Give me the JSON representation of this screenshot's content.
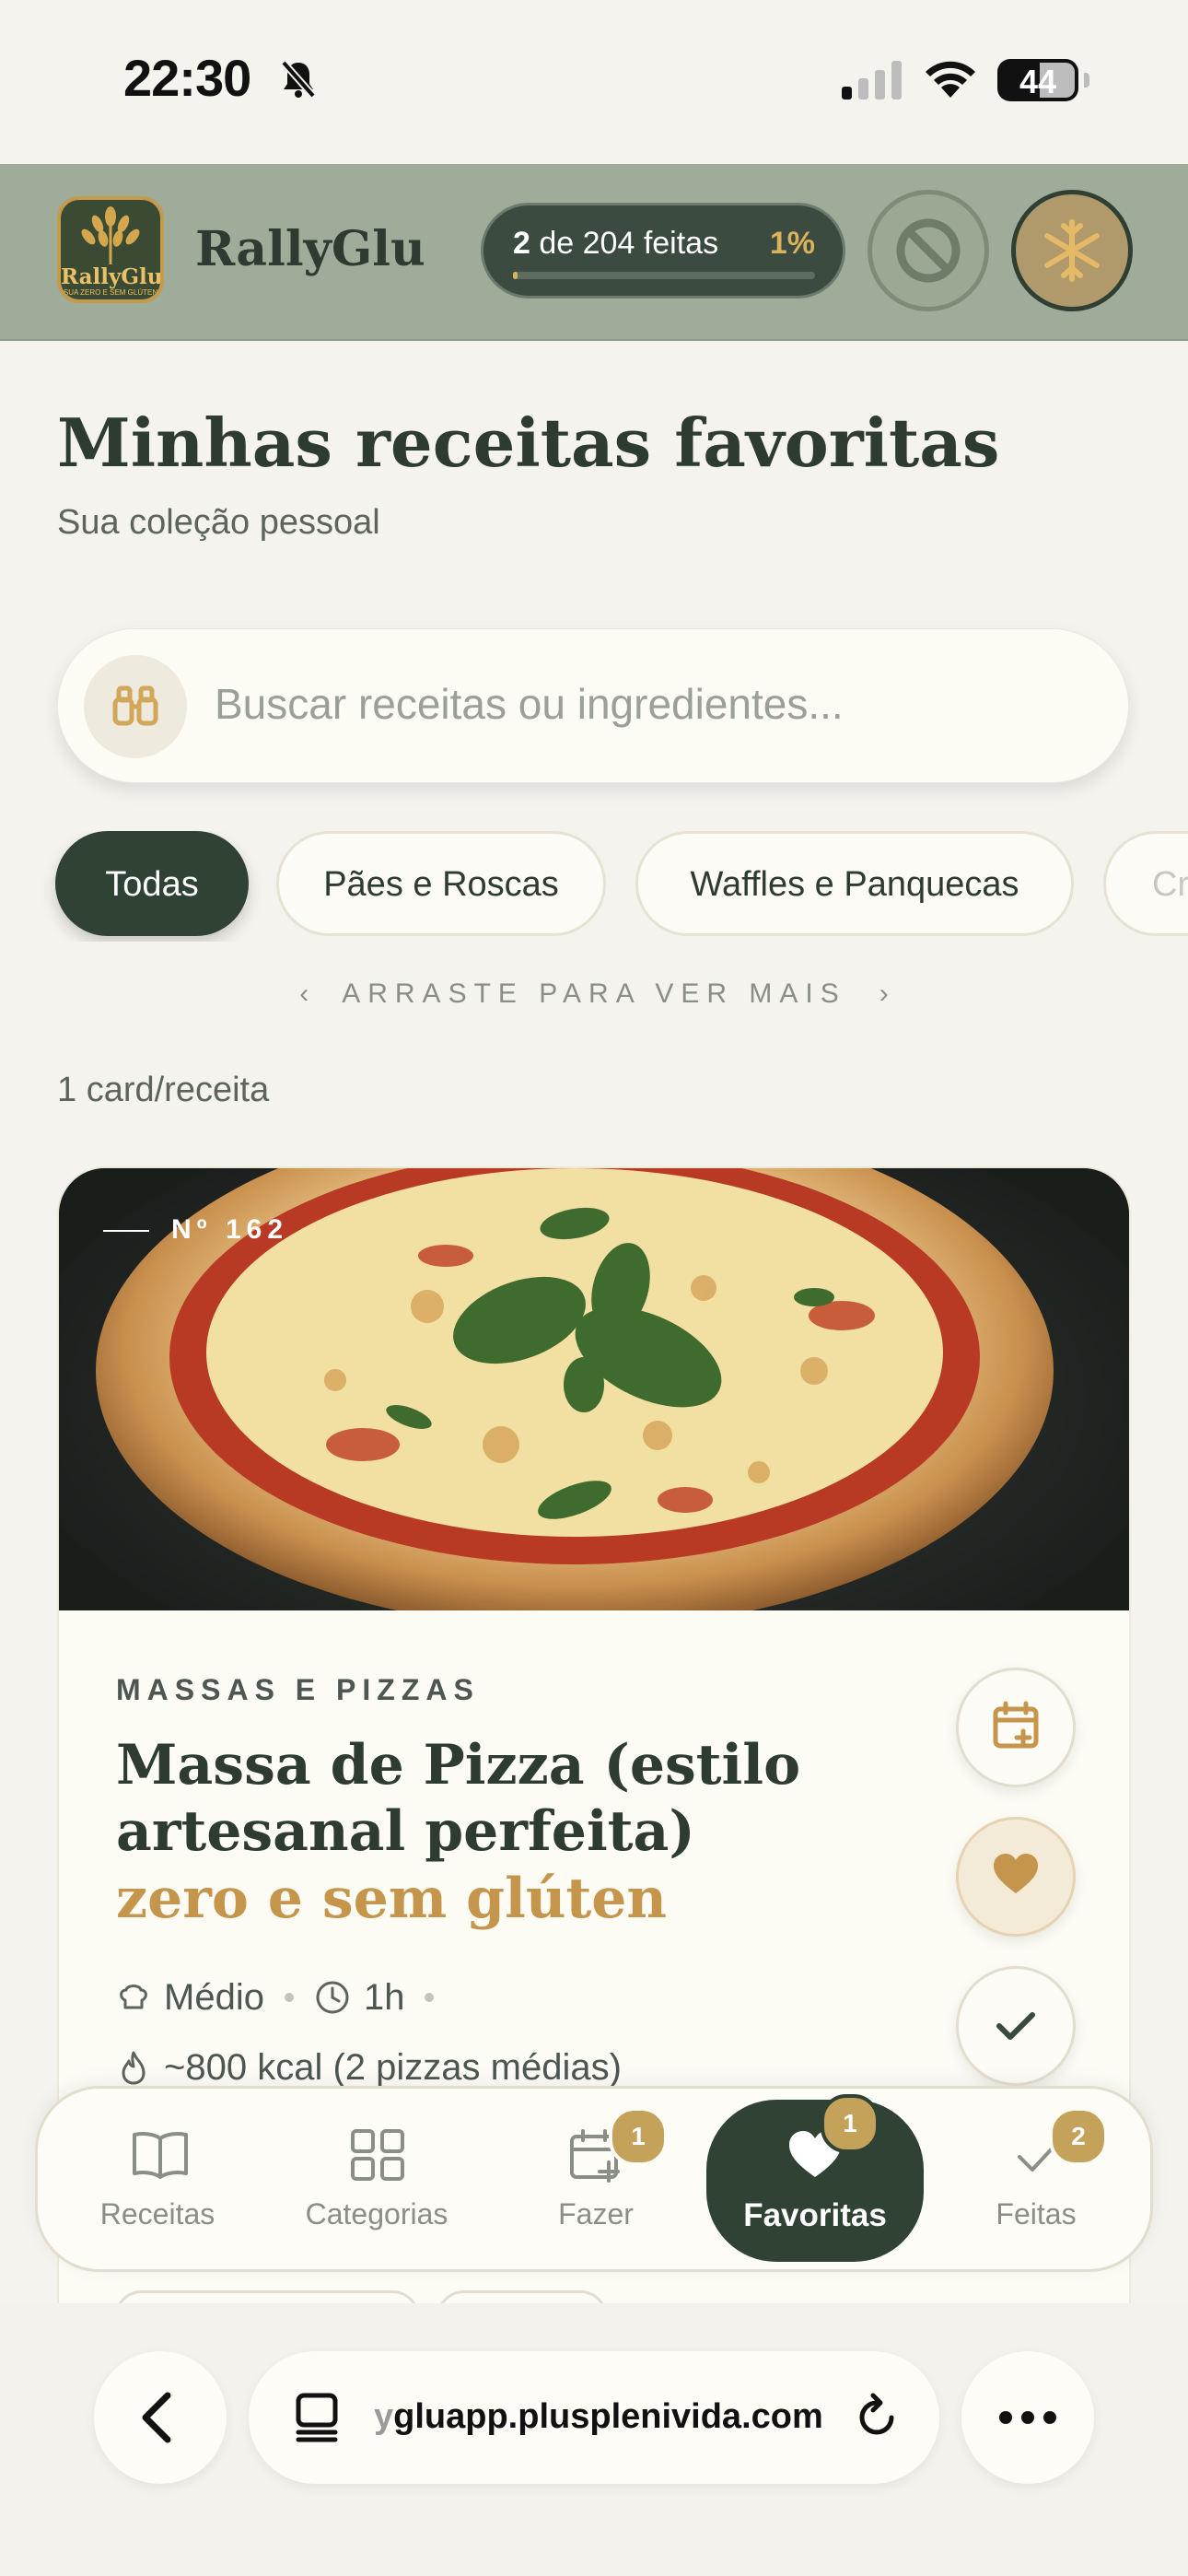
{
  "status": {
    "time": "22:30",
    "battery": "44"
  },
  "app": {
    "brand": "RallyGlu",
    "logo_text": "RallyGlu",
    "logo_subtext": "SUA ZERO E SEM GLÚTEN",
    "progress": {
      "done": "2",
      "label_rest": "de 204 feitas",
      "percent": "1%",
      "fraction": 0.01
    }
  },
  "page": {
    "title": "Minhas receitas favoritas",
    "subtitle": "Sua coleção pessoal"
  },
  "search": {
    "placeholder": "Buscar receitas ou ingredientes..."
  },
  "chips": [
    {
      "label": "Todas",
      "active": true
    },
    {
      "label": "Pães e Roscas",
      "active": false
    },
    {
      "label": "Waffles e Panquecas",
      "active": false
    },
    {
      "label": "Cr",
      "active": false
    }
  ],
  "drag_hint": {
    "text": "ARRASTE PARA VER MAIS",
    "left": "‹",
    "right": "›"
  },
  "view_mode": "1 card/receita",
  "recipe": {
    "number": "Nº 162",
    "category": "MASSAS E PIZZAS",
    "title": "Massa de Pizza (estilo artesanal perfeita)",
    "title_highlight": "zero e sem glúten",
    "difficulty": "Médio",
    "time": "1h",
    "calories": "~800 kcal (2 pizzas médias)"
  },
  "bottom_nav": [
    {
      "label": "Receitas",
      "badge": ""
    },
    {
      "label": "Categorias",
      "badge": ""
    },
    {
      "label": "Fazer",
      "badge": "1"
    },
    {
      "label": "Favoritas",
      "badge": "1",
      "active": true
    },
    {
      "label": "Feitas",
      "badge": "2"
    }
  ],
  "browser": {
    "url_faded": "y",
    "url": "gluapp.plusplenivida.com"
  },
  "colors": {
    "accent_dark": "#2f4233",
    "gold": "#c4954b",
    "header_bg": "#9fac99"
  }
}
